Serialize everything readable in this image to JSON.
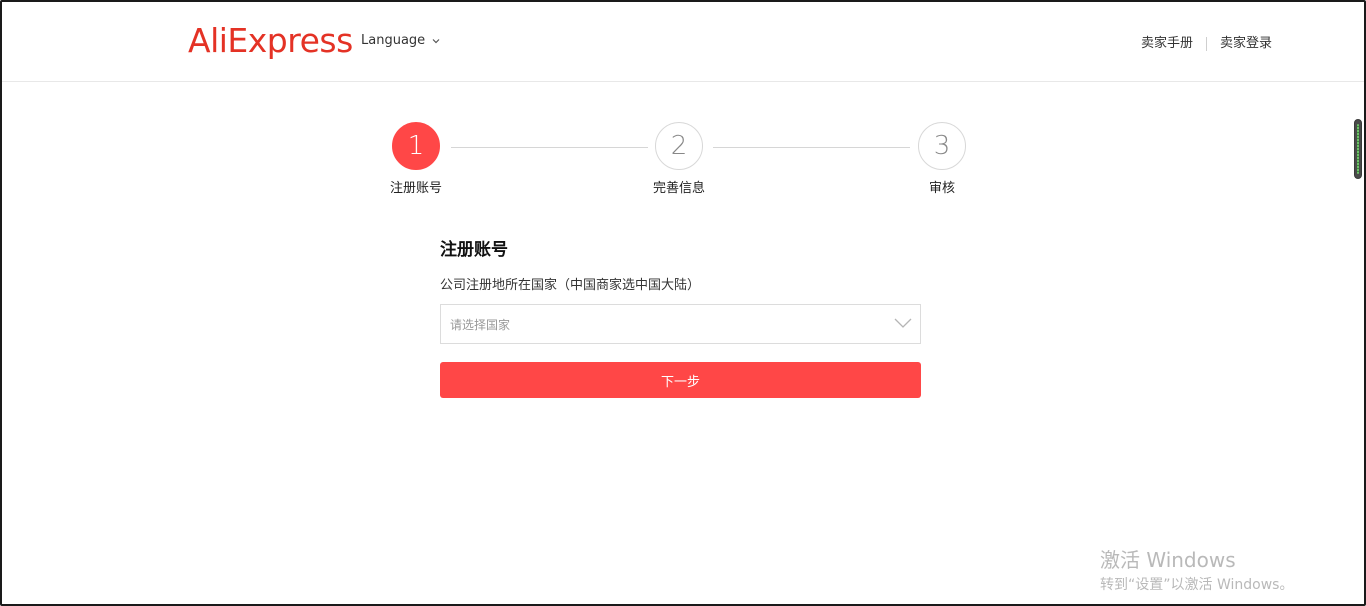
{
  "header": {
    "logo": "AliExpress",
    "language_label": "Language",
    "links": [
      "卖家手册",
      "卖家登录"
    ]
  },
  "steps": [
    {
      "number": "1",
      "label": "注册账号",
      "active": true
    },
    {
      "number": "2",
      "label": "完善信息",
      "active": false
    },
    {
      "number": "3",
      "label": "审核",
      "active": false
    }
  ],
  "form": {
    "title": "注册账号",
    "country_label": "公司注册地所在国家（中国商家选中国大陆）",
    "country_placeholder": "请选择国家",
    "next_button": "下一步"
  },
  "watermark": {
    "line1": "激活 Windows",
    "line2": "转到“设置”以激活 Windows。"
  },
  "colors": {
    "brand": "#e43225",
    "accent": "#ff4747",
    "border": "#dcdcdc"
  }
}
